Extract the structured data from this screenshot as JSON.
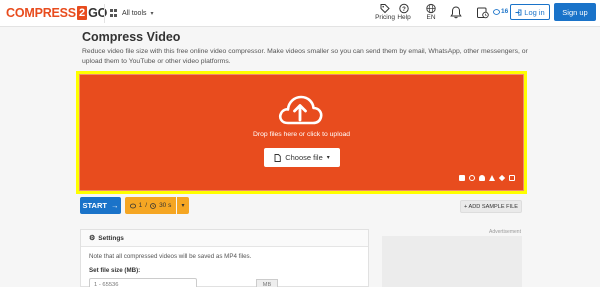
{
  "header": {
    "logo_left": "COMPRESS",
    "logo_mid": "2",
    "logo_right": "GO",
    "all_tools": "All tools",
    "pricing": "Pricing",
    "help": "Help",
    "language": "EN",
    "credits": "16",
    "login": "Log in",
    "signup": "Sign up"
  },
  "page": {
    "title": "Compress Video",
    "description": "Reduce video file size with this free online video compressor. Make videos smaller so you can send them by email, WhatsApp, other messengers, or upload them to YouTube or other video platforms."
  },
  "upload": {
    "drop_text": "Drop files here or click to upload",
    "choose_file": "Choose file",
    "highlight_color": "#ffff00",
    "accent_color": "#e84c1e"
  },
  "actions": {
    "start": "START",
    "limit_files": "1",
    "limit_separator": "/",
    "limit_time": "30 s",
    "add_sample": "+ ADD SAMPLE FILE"
  },
  "settings": {
    "title": "Settings",
    "note": "Note that all compressed videos will be saved as MP4 files.",
    "file_size_label": "Set file size (MB):",
    "file_size_placeholder": "1 - 65536",
    "file_size_unit": "MB"
  },
  "ad": {
    "label": "Advertisement"
  }
}
